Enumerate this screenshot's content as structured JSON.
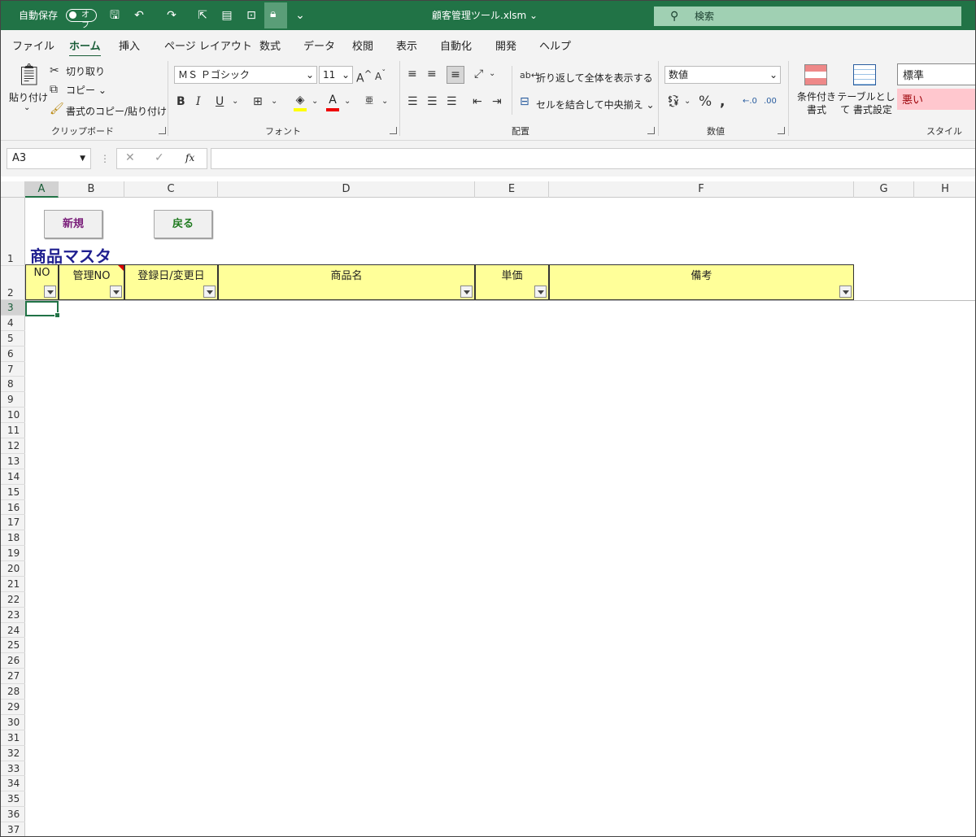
{
  "titlebar": {
    "autosave_label": "自動保存",
    "autosave_state": "オフ",
    "filename": "顧客管理ツール.xlsm",
    "search_placeholder": "検索"
  },
  "tabs": [
    "ファイル",
    "ホーム",
    "挿入",
    "ページ レイアウト",
    "数式",
    "データ",
    "校閲",
    "表示",
    "自動化",
    "開発",
    "ヘルプ"
  ],
  "ribbon": {
    "clipboard": {
      "paste": "貼り付け",
      "cut": "切り取り",
      "copy": "コピー",
      "format_painter": "書式のコピー/貼り付け",
      "group": "クリップボード"
    },
    "font": {
      "name": "ＭＳ Ｐゴシック",
      "size": "11",
      "bold": "B",
      "italic": "I",
      "underline": "U",
      "group": "フォント"
    },
    "alignment": {
      "wrap": "折り返して全体を表示する",
      "merge": "セルを結合して中央揃え",
      "group": "配置"
    },
    "number": {
      "format": "数値",
      "group": "数値"
    },
    "styles": {
      "conditional": "条件付き 書式",
      "table": "テーブルとして 書式設定",
      "normal": "標準",
      "bad": "悪い",
      "group": "スタイル"
    }
  },
  "formula_bar": {
    "name_box": "A3",
    "fx": "fx"
  },
  "columns": [
    "A",
    "B",
    "C",
    "D",
    "E",
    "F",
    "G",
    "H"
  ],
  "sheet": {
    "new_button": "新規",
    "back_button": "戻る",
    "title": "商品マスタ",
    "headers": [
      "NO",
      "管理NO",
      "登録日/変更日",
      "商品名",
      "単価",
      "備考"
    ],
    "rows": [
      "1",
      "2",
      "3",
      "4",
      "5",
      "6",
      "7",
      "8",
      "9",
      "10",
      "11",
      "12",
      "13",
      "14",
      "15",
      "16",
      "17",
      "18",
      "19",
      "20",
      "21",
      "22",
      "23",
      "24",
      "25",
      "26",
      "27",
      "28",
      "29",
      "30",
      "31",
      "32",
      "33",
      "34",
      "35",
      "36",
      "37"
    ]
  },
  "colors": {
    "excel_green": "#217346",
    "header_fill": "#ffff99",
    "title_color": "#1f1f8f",
    "new_btn_text": "#7a1f7a",
    "back_btn_text": "#1f7a1f"
  }
}
